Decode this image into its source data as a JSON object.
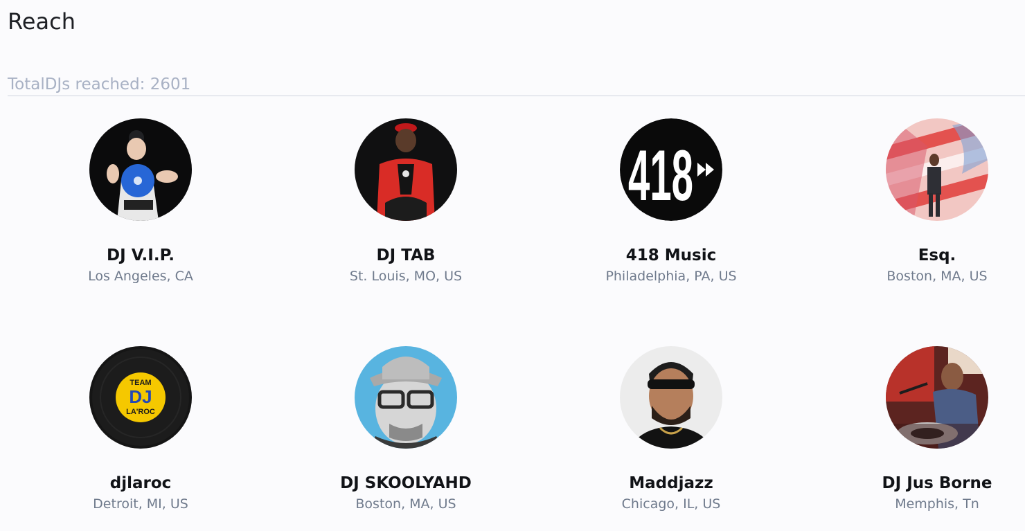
{
  "header": {
    "title": "Reach",
    "total_label": "TotalDJs reached: 2601"
  },
  "djs": [
    {
      "name": "DJ V.I.P.",
      "location": "Los Angeles, CA",
      "avatar": "dj-holding-blue-record-photo"
    },
    {
      "name": "DJ TAB",
      "location": "St. Louis, MO, US",
      "avatar": "dj-red-jacket-photo"
    },
    {
      "name": "418 Music",
      "location": "Philadelphia, PA, US",
      "avatar": "418-logo",
      "logo_text": "418"
    },
    {
      "name": "Esq.",
      "location": "Boston, MA, US",
      "avatar": "dj-colorful-stage-photo"
    },
    {
      "name": "djlaroc",
      "location": "Detroit, MI, US",
      "avatar": "team-dj-laroc-record-logo",
      "logo_lines": [
        "TEAM",
        "DJ",
        "LA'ROC"
      ]
    },
    {
      "name": "DJ SKOOLYAHD",
      "location": "Boston, MA, US",
      "avatar": "dj-cap-glasses-photo"
    },
    {
      "name": "Maddjazz",
      "location": "Chicago, IL, US",
      "avatar": "dj-sunglasses-photo"
    },
    {
      "name": "DJ Jus Borne",
      "location": "Memphis, Tn",
      "avatar": "dj-at-turntables-photo"
    }
  ],
  "colors": {
    "background": "#fbfbfd",
    "muted_text": "#a8b1c4",
    "location_text": "#6f7a8c",
    "divider": "#cdd3de"
  }
}
